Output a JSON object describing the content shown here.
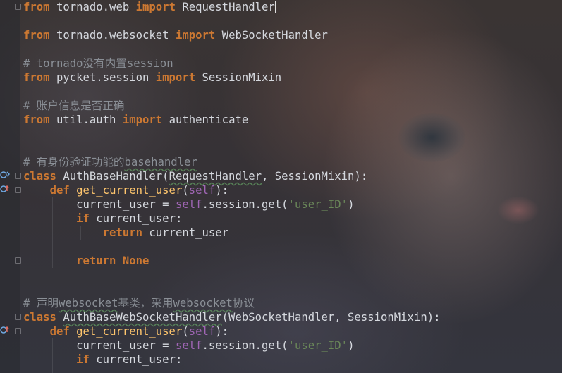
{
  "editor": {
    "lines": [
      [
        {
          "t": "from",
          "c": "kw"
        },
        {
          "t": " tornado.web ",
          "c": ""
        },
        {
          "t": "import",
          "c": "kw"
        },
        {
          "t": " RequestHandler",
          "c": ""
        }
      ],
      [],
      [
        {
          "t": "from",
          "c": "kw"
        },
        {
          "t": " tornado.websocket ",
          "c": ""
        },
        {
          "t": "import",
          "c": "kw"
        },
        {
          "t": " WebSocketHandler",
          "c": ""
        }
      ],
      [],
      [
        {
          "t": "# tornado没有内置session",
          "c": "cm"
        }
      ],
      [
        {
          "t": "from",
          "c": "kw"
        },
        {
          "t": " pycket.session ",
          "c": ""
        },
        {
          "t": "import",
          "c": "kw"
        },
        {
          "t": " SessionMixin",
          "c": ""
        }
      ],
      [],
      [
        {
          "t": "# 账户信息是否正确",
          "c": "cm"
        }
      ],
      [
        {
          "t": "from",
          "c": "kw"
        },
        {
          "t": " util.auth ",
          "c": ""
        },
        {
          "t": "import",
          "c": "kw"
        },
        {
          "t": " authenticate",
          "c": ""
        }
      ],
      [],
      [],
      [
        {
          "t": "# 有身份验证功能的",
          "c": "cm"
        },
        {
          "t": "basehandler",
          "c": "cm uline"
        }
      ],
      [
        {
          "t": "class",
          "c": "kw"
        },
        {
          "t": " ",
          "c": ""
        },
        {
          "t": "AuthBaseHandler",
          "c": ""
        },
        {
          "t": "(",
          "c": ""
        },
        {
          "t": "RequestHandler",
          "c": "uline"
        },
        {
          "t": ", SessionMixin):",
          "c": ""
        }
      ],
      [
        {
          "t": "    ",
          "c": ""
        },
        {
          "t": "def",
          "c": "kw"
        },
        {
          "t": " ",
          "c": ""
        },
        {
          "t": "get_current_user",
          "c": "fn"
        },
        {
          "t": "(",
          "c": ""
        },
        {
          "t": "self",
          "c": "sf"
        },
        {
          "t": "):",
          "c": ""
        }
      ],
      [
        {
          "t": "        current_user = ",
          "c": ""
        },
        {
          "t": "self",
          "c": "sf"
        },
        {
          "t": ".session.get(",
          "c": ""
        },
        {
          "t": "'user_ID'",
          "c": "st"
        },
        {
          "t": ")",
          "c": ""
        }
      ],
      [
        {
          "t": "        ",
          "c": ""
        },
        {
          "t": "if",
          "c": "kw"
        },
        {
          "t": " current_user:",
          "c": ""
        }
      ],
      [
        {
          "t": "            ",
          "c": ""
        },
        {
          "t": "return",
          "c": "kw"
        },
        {
          "t": " current_user",
          "c": ""
        }
      ],
      [],
      [
        {
          "t": "        ",
          "c": ""
        },
        {
          "t": "return",
          "c": "kw"
        },
        {
          "t": " ",
          "c": ""
        },
        {
          "t": "None",
          "c": "kw"
        }
      ],
      [],
      [],
      [
        {
          "t": "# 声明",
          "c": "cm"
        },
        {
          "t": "websocket",
          "c": "cm uline"
        },
        {
          "t": "基类，采用",
          "c": "cm"
        },
        {
          "t": "websocket",
          "c": "cm uline"
        },
        {
          "t": "协议",
          "c": "cm"
        }
      ],
      [
        {
          "t": "class",
          "c": "kw"
        },
        {
          "t": " ",
          "c": ""
        },
        {
          "t": "AuthBaseWebSocketHandler",
          "c": "uline"
        },
        {
          "t": "(WebSocketHandler, SessionMixin):",
          "c": ""
        }
      ],
      [
        {
          "t": "    ",
          "c": ""
        },
        {
          "t": "def",
          "c": "kw"
        },
        {
          "t": " ",
          "c": ""
        },
        {
          "t": "get_current_user",
          "c": "fn"
        },
        {
          "t": "(",
          "c": ""
        },
        {
          "t": "self",
          "c": "sf"
        },
        {
          "t": "):",
          "c": ""
        }
      ],
      [
        {
          "t": "        current_user = ",
          "c": ""
        },
        {
          "t": "self",
          "c": "sf"
        },
        {
          "t": ".session.get(",
          "c": ""
        },
        {
          "t": "'user_ID'",
          "c": "st"
        },
        {
          "t": ")",
          "c": ""
        }
      ],
      [
        {
          "t": "        ",
          "c": ""
        },
        {
          "t": "if",
          "c": "kw"
        },
        {
          "t": " current_user:",
          "c": ""
        }
      ]
    ]
  },
  "colors": {
    "keyword": "#cc7832",
    "comment": "#8a8f96",
    "string": "#6a8759",
    "self": "#a066b5",
    "function": "#ffc66d",
    "text": "#d5d8de"
  },
  "gutter": {
    "icons": [
      "override-marker-icon",
      "implemented-marker-icon",
      "fold-marker-icon"
    ]
  }
}
